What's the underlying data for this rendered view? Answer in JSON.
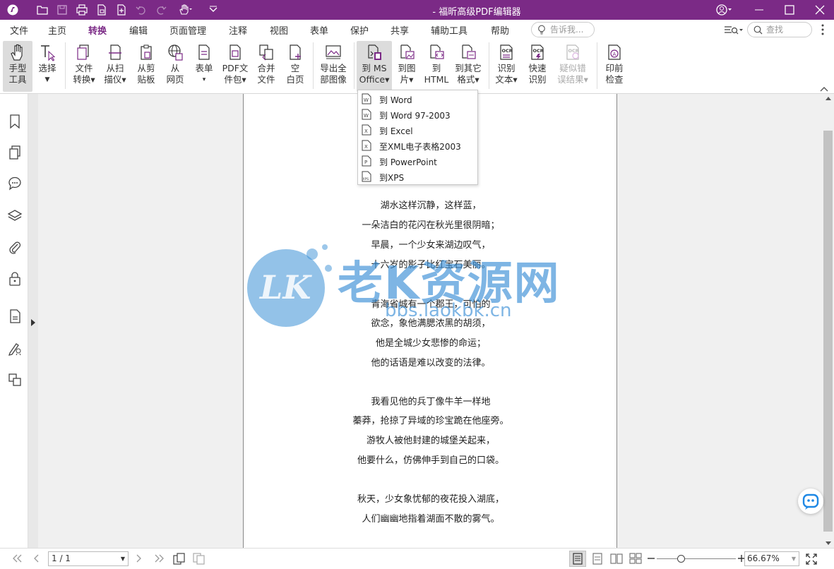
{
  "window": {
    "title": "- 福昕高级PDF编辑器"
  },
  "menu": {
    "tabs": [
      "文件",
      "主页",
      "转换",
      "编辑",
      "页面管理",
      "注释",
      "视图",
      "表单",
      "保护",
      "共享",
      "辅助工具",
      "帮助"
    ],
    "active": "转换",
    "tellme_placeholder": "告诉我...",
    "search_placeholder": "查找"
  },
  "ribbon": {
    "hand": [
      "手型",
      "工具"
    ],
    "select": [
      "选择"
    ],
    "file_convert": [
      "文件",
      "转换▾"
    ],
    "from_scan": [
      "从扫",
      "描仪▾"
    ],
    "from_clip": [
      "从剪",
      "贴板"
    ],
    "from_web": [
      "从",
      "网页"
    ],
    "form": [
      "表单",
      "▾"
    ],
    "pdf_pkg": [
      "PDF文",
      "件包▾"
    ],
    "merge": [
      "合并",
      "文件"
    ],
    "blank": [
      "空",
      "白页"
    ],
    "export_img": [
      "导出全",
      "部图像"
    ],
    "to_ms": [
      "到 MS",
      "Office▾"
    ],
    "to_img": [
      "到图",
      "片▾"
    ],
    "to_html": [
      "到",
      "HTML"
    ],
    "to_other": [
      "到其它",
      "格式▾"
    ],
    "ocr": [
      "识别",
      "文本▾"
    ],
    "quick_ocr": [
      "快速",
      "识别"
    ],
    "suspect": [
      "疑似错",
      "误结果▾"
    ],
    "preflight": [
      "印前",
      "检查"
    ]
  },
  "dropdown": {
    "items": [
      "到 Word",
      "到 Word 97-2003",
      "到 Excel",
      "至XML电子表格2003",
      "到 PowerPoint",
      "到XPS"
    ]
  },
  "document": {
    "lines": [
      "湖水这样沉静，这样蓝，",
      "一朵洁白的花闪在秋光里很阴暗；",
      "早晨，一个少女来湖边叹气，",
      "十六岁的影子比红宝石美丽。",
      "",
      "青海省城有一个郡王，可怕的",
      "欲念，象他满腮浓黑的胡须，",
      "他是全城少女悲惨的命运；",
      "他的话语是难以改变的法律。",
      "",
      "我看见他的兵丁像牛羊一样地",
      "蓁莽，抢掠了异域的珍宝跪在他座旁。",
      "游牧人被他封建的城堡关起来，",
      "他要什么，仿佛伸手到自己的口袋。",
      "",
      "秋天，少女象忧郁的夜花投入湖底，",
      "人们幽幽地指着湖面不散的雾气。"
    ]
  },
  "watermark": {
    "logo": "LK",
    "name": "老K资源网",
    "url": "bbs.laokbk.cn"
  },
  "status": {
    "page": "1 / 1",
    "zoom": "66.67%"
  },
  "colors": {
    "brand": "#7b2a86",
    "watermark": "#3a8fd6"
  }
}
